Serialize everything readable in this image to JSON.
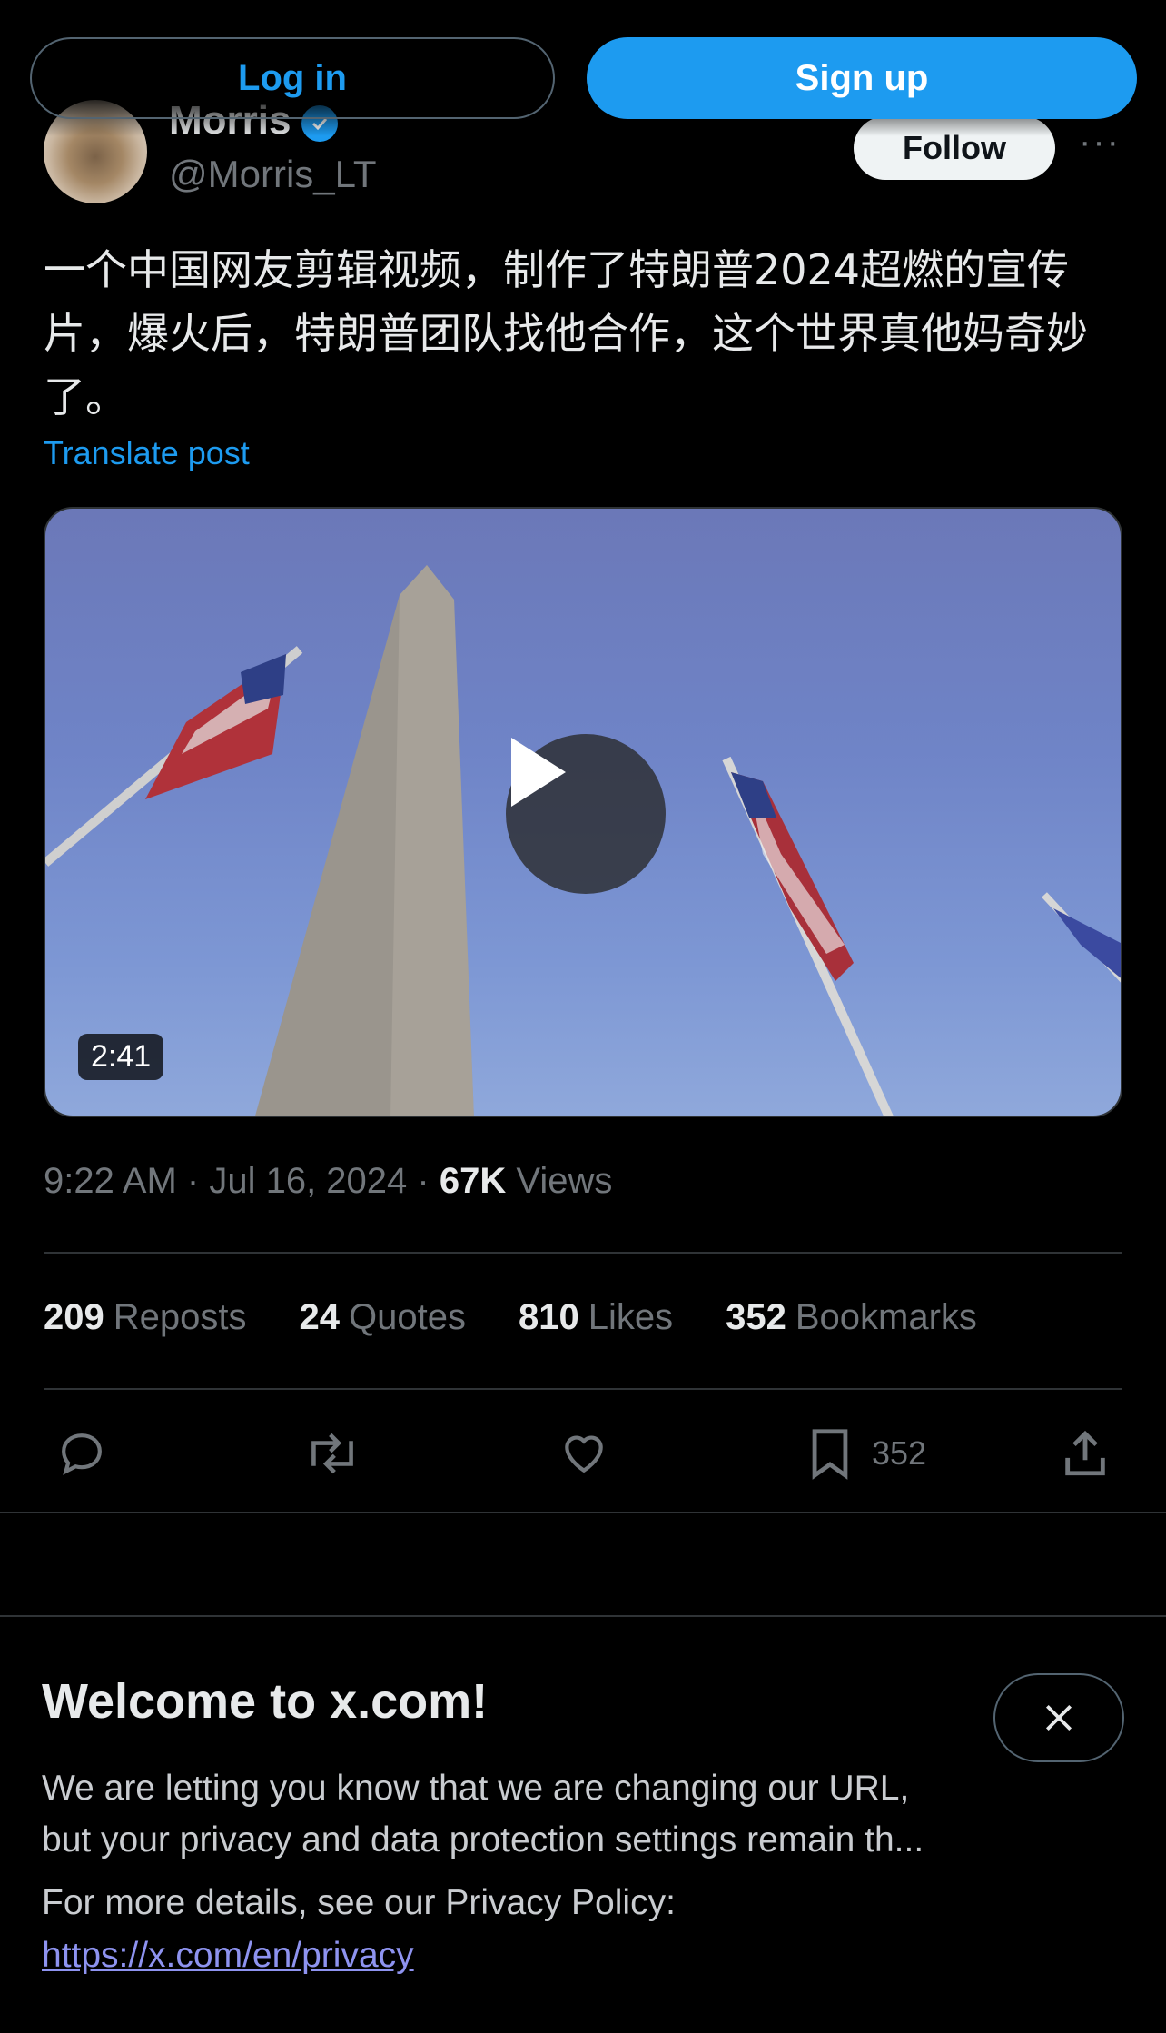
{
  "auth": {
    "login_label": "Log in",
    "signup_label": "Sign up"
  },
  "author": {
    "name": "Morris",
    "handle": "@Morris_LT",
    "follow_label": "Follow",
    "more_label": "···"
  },
  "post": {
    "text": "一个中国网友剪辑视频，制作了特朗普2024超燃的宣传片，爆火后，特朗普团队找他合作，这个世界真他妈奇妙了。",
    "translate_label": "Translate post",
    "video": {
      "duration": "2:41"
    },
    "time": "9:22 AM",
    "date": "Jul 16, 2024",
    "views_count": "67K",
    "views_label": "Views",
    "separator": "·"
  },
  "stats": [
    {
      "count": "209",
      "label": "Reposts"
    },
    {
      "count": "24",
      "label": "Quotes"
    },
    {
      "count": "810",
      "label": "Likes"
    },
    {
      "count": "352",
      "label": "Bookmarks"
    }
  ],
  "actions": {
    "reply_icon": "reply-icon",
    "repost_icon": "repost-icon",
    "like_icon": "heart-icon",
    "bookmark_icon": "bookmark-icon",
    "bookmark_count": "352",
    "share_icon": "share-icon"
  },
  "welcome": {
    "title": "Welcome to x.com!",
    "body_line1": "We are letting you know that we are changing our URL,",
    "body_line2": "but your privacy and data protection settings remain th...",
    "details": "For more details, see our Privacy Policy:",
    "link": "https://x.com/en/privacy"
  },
  "colors": {
    "accent": "#1d9bf0",
    "background": "#000000",
    "muted": "#71767b",
    "divider": "#2f3336"
  }
}
